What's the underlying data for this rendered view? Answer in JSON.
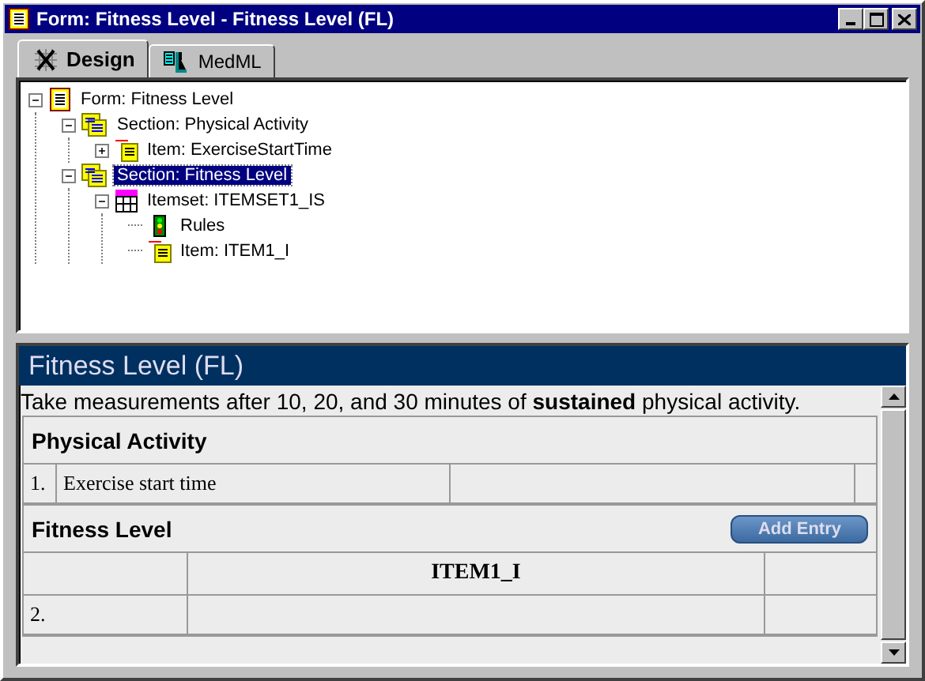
{
  "window": {
    "title": "Form: Fitness Level - Fitness Level (FL)"
  },
  "tabs": [
    {
      "label": "Design",
      "kind": "design",
      "selected": true
    },
    {
      "label": "MedML",
      "kind": "medml",
      "selected": false
    }
  ],
  "tree": [
    {
      "label": "Form: Fitness Level",
      "kind": "form",
      "expanded": true,
      "selected": false,
      "children": [
        {
          "label": "Section: Physical Activity",
          "kind": "section",
          "expanded": true,
          "selected": false,
          "children": [
            {
              "label": "Item: ExerciseStartTime",
              "kind": "item",
              "expanded": false,
              "selected": false
            }
          ]
        },
        {
          "label": "Section: Fitness Level",
          "kind": "section",
          "expanded": true,
          "selected": true,
          "children": [
            {
              "label": "Itemset: ITEMSET1_IS",
              "kind": "itemset",
              "expanded": true,
              "selected": false,
              "children": [
                {
                  "label": "Rules",
                  "kind": "rules",
                  "selected": false
                },
                {
                  "label": "Item: ITEM1_I",
                  "kind": "item",
                  "selected": false
                }
              ]
            }
          ]
        }
      ]
    }
  ],
  "preview": {
    "title": "Fitness Level (FL)",
    "instruction": "Take measurements after 10, 20, and 30 minutes of **sustained** physical activity.",
    "sections": [
      {
        "kind": "list",
        "heading": "Physical Activity",
        "rows": [
          {
            "number": "1.",
            "label": "Exercise start time"
          }
        ]
      },
      {
        "kind": "grid",
        "heading": "Fitness Level",
        "button": "Add Entry",
        "columns": [
          "ITEM1_I"
        ],
        "rows": [
          {
            "number": "2."
          }
        ]
      }
    ]
  }
}
